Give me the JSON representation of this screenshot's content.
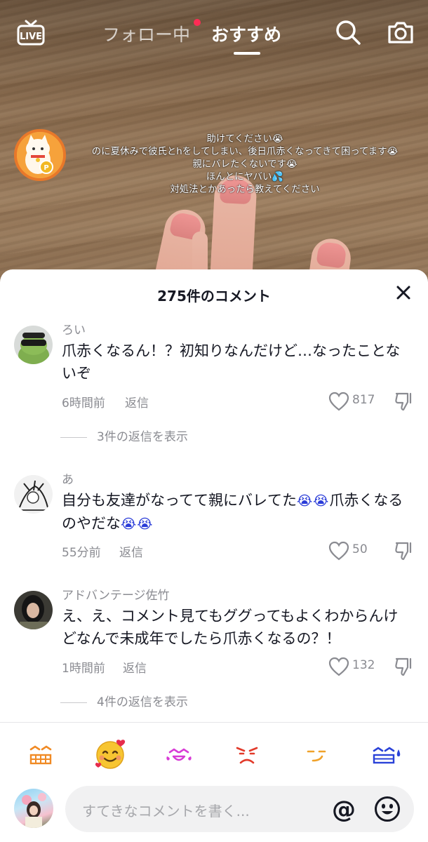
{
  "topbar": {
    "live_label": "LIVE",
    "tabs": [
      {
        "label": "フォロー中",
        "has_dot": true
      },
      {
        "label": "おすすめ",
        "active": true
      }
    ]
  },
  "video": {
    "overlay_lines": [
      "助けてください😭",
      "のに夏休みで彼氏とhをしてしまい、後日爪赤くなってきて困ってます😭",
      "親にバレたくないです😭",
      "ほんとにヤバい💦",
      "対処法とかあったら教えてください"
    ]
  },
  "sheet": {
    "title": "275件のコメント",
    "comments": [
      {
        "username": "ろい",
        "text": "爪赤くなるん！？初知りなんだけど…なったことないぞ",
        "time": "6時間前",
        "reply_label": "返信",
        "likes": "817",
        "view_replies": "3件の返信を表示"
      },
      {
        "username": "あ",
        "text_before": "自分も友達がなってて親にバレてた",
        "emoji_a": "😭😭",
        "text_mid": "爪赤くなるのやだな",
        "emoji_b": "😭😭",
        "time": "55分前",
        "reply_label": "返信",
        "likes": "50"
      },
      {
        "username": "アドバンテージ佐竹",
        "text": "え、え、コメント見てもググってもよくわからんけどなんで未成年でしたら爪赤くなるの？！",
        "time": "1時間前",
        "reply_label": "返信",
        "likes": "132",
        "view_replies": "4件の返信を表示"
      }
    ]
  },
  "composer": {
    "placeholder": "すてきなコメントを書く...",
    "at_symbol": "@"
  },
  "colors": {
    "accent_red": "#fe2c55",
    "text_primary": "#161823",
    "text_secondary": "#8a8b91"
  }
}
